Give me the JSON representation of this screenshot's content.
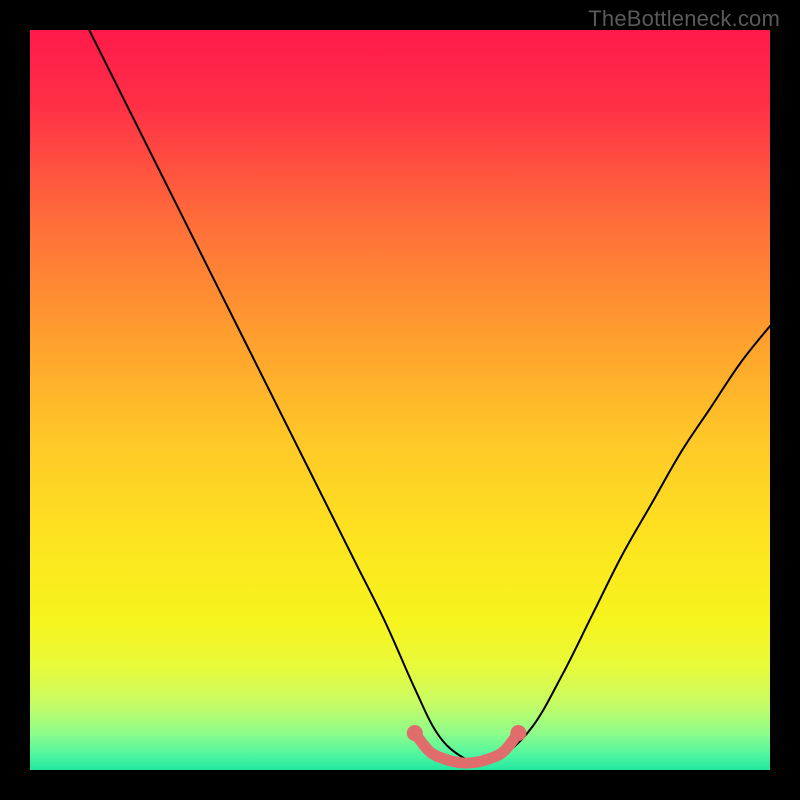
{
  "watermark": "TheBottleneck.com",
  "gradient_stops": [
    {
      "offset": 0.0,
      "color": "#ff1a4b"
    },
    {
      "offset": 0.1,
      "color": "#ff2f46"
    },
    {
      "offset": 0.25,
      "color": "#ff6a3a"
    },
    {
      "offset": 0.4,
      "color": "#ff9a2f"
    },
    {
      "offset": 0.55,
      "color": "#ffc728"
    },
    {
      "offset": 0.7,
      "color": "#fde61f"
    },
    {
      "offset": 0.8,
      "color": "#f6f41e"
    },
    {
      "offset": 0.86,
      "color": "#e8fa3a"
    },
    {
      "offset": 0.91,
      "color": "#c7fb64"
    },
    {
      "offset": 0.95,
      "color": "#8efc8a"
    },
    {
      "offset": 0.98,
      "color": "#4ef6a0"
    },
    {
      "offset": 1.0,
      "color": "#23e7a1"
    }
  ],
  "chart_data": {
    "type": "line",
    "title": "",
    "xlabel": "",
    "ylabel": "",
    "xlim": [
      0,
      100
    ],
    "ylim": [
      0,
      100
    ],
    "annotations": [
      "TheBottleneck.com"
    ],
    "series": [
      {
        "name": "bottleneck-curve",
        "x": [
          8,
          12,
          16,
          20,
          24,
          28,
          32,
          36,
          40,
          44,
          48,
          52,
          55,
          58,
          61,
          64,
          68,
          72,
          76,
          80,
          84,
          88,
          92,
          96,
          100
        ],
        "y": [
          100,
          92,
          84,
          76,
          68,
          60,
          52,
          44,
          36,
          28,
          20,
          11,
          5,
          2,
          1,
          2,
          6,
          13,
          21,
          29,
          36,
          43,
          49,
          55,
          60
        ]
      },
      {
        "name": "bottom-highlight",
        "x": [
          52,
          54,
          56,
          58,
          60,
          62,
          64,
          66
        ],
        "y": [
          5,
          2.5,
          1.5,
          1,
          1,
          1.5,
          2.5,
          5
        ]
      }
    ],
    "styles": {
      "bottleneck-curve": {
        "stroke": "#000000",
        "width": 2
      },
      "bottom-highlight": {
        "stroke": "#e06c6c",
        "width": 11,
        "endpoint_radius": 8
      }
    }
  }
}
